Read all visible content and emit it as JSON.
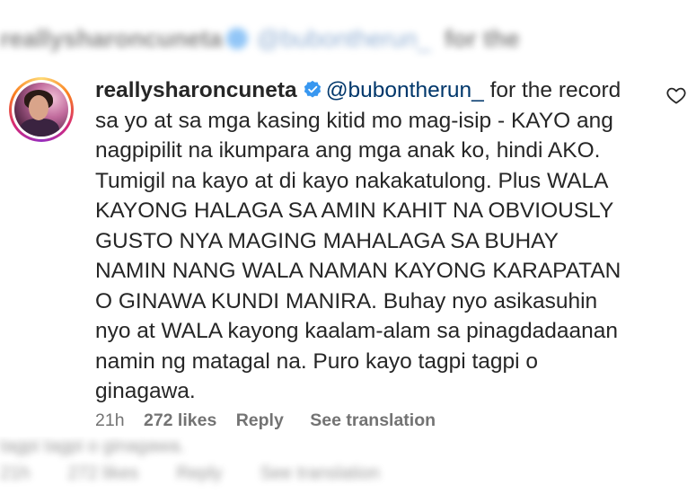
{
  "ghost_top": {
    "username": "reallysharoncuneta",
    "mention": "@bubontherun_",
    "text": "for the"
  },
  "ghost_bottom": {
    "line1": "tagpi tagpi o ginagawa.",
    "time": "21h",
    "likes": "272 likes",
    "reply": "Reply",
    "see_translation": "See translation"
  },
  "comment": {
    "username": "reallysharoncuneta",
    "mention": "@bubontherun_",
    "text": " for the record sa yo at sa mga kasing kitid mo mag-isip - KAYO ang nagpipilit na ikumpara ang mga anak ko, hindi AKO. Tumigil na kayo at di kayo nakakatulong. Plus WALA KAYONG HALAGA SA AMIN KAHIT NA OBVIOUSLY GUSTO NYA MAGING MAHALAGA SA BUHAY NAMIN NANG WALA NAMAN KAYONG KARAPATAN O GINAWA KUNDI MANIRA. Buhay nyo asikasuhin nyo at WALA kayong kaalam-alam sa pinagdadaanan namin ng matagal na. Puro kayo tagpi tagpi o ginagawa.",
    "time": "21h",
    "likes": "272 likes",
    "reply": "Reply",
    "see_translation": "See translation"
  },
  "colors": {
    "mention": "#00376b",
    "meta": "#737373",
    "verified": "#3897f0",
    "text": "#262626"
  },
  "icons": {
    "verified": "verified-badge-icon",
    "like": "heart-outline-icon"
  }
}
